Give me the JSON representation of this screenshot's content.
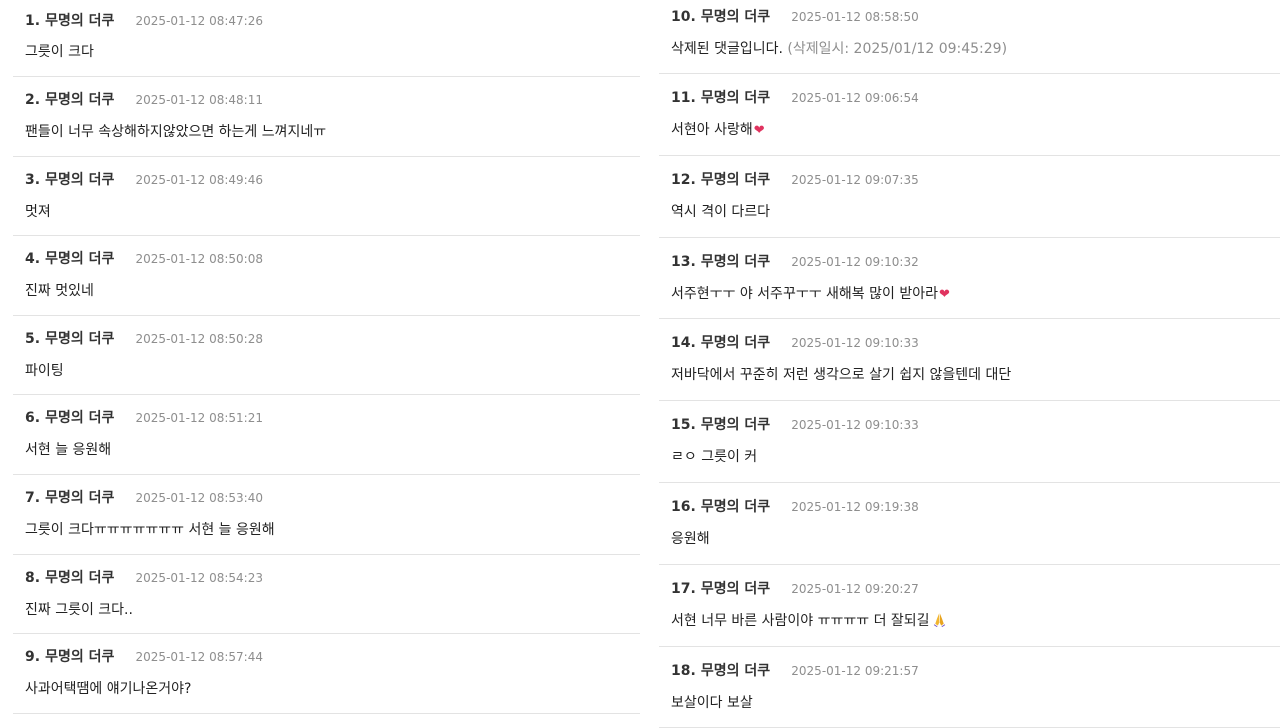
{
  "comments_left": [
    {
      "num": "1.",
      "author": "무명의 더쿠",
      "date": "2025-01-12 08:47:26",
      "text": "그릇이 크다"
    },
    {
      "num": "2.",
      "author": "무명의 더쿠",
      "date": "2025-01-12 08:48:11",
      "text": "팬들이 너무 속상해하지않았으면 하는게 느껴지네ㅠ"
    },
    {
      "num": "3.",
      "author": "무명의 더쿠",
      "date": "2025-01-12 08:49:46",
      "text": "멋져"
    },
    {
      "num": "4.",
      "author": "무명의 더쿠",
      "date": "2025-01-12 08:50:08",
      "text": "진짜 멋있네"
    },
    {
      "num": "5.",
      "author": "무명의 더쿠",
      "date": "2025-01-12 08:50:28",
      "text": "파이팅"
    },
    {
      "num": "6.",
      "author": "무명의 더쿠",
      "date": "2025-01-12 08:51:21",
      "text": "서현 늘 응원해"
    },
    {
      "num": "7.",
      "author": "무명의 더쿠",
      "date": "2025-01-12 08:53:40",
      "text": "그릇이 크다ㅠㅠㅠㅠㅠㅠㅠ 서현 늘 응원해"
    },
    {
      "num": "8.",
      "author": "무명의 더쿠",
      "date": "2025-01-12 08:54:23",
      "text": "진짜 그릇이 크다.."
    },
    {
      "num": "9.",
      "author": "무명의 더쿠",
      "date": "2025-01-12 08:57:44",
      "text": "사과어택땜에 얘기나온거야?"
    }
  ],
  "comments_right": [
    {
      "num": "10.",
      "author": "무명의 더쿠",
      "date": "2025-01-12 08:58:50",
      "text": "삭제된 댓글입니다.",
      "deleted_note": "(삭제일시: 2025/01/12 09:45:29)"
    },
    {
      "num": "11.",
      "author": "무명의 더쿠",
      "date": "2025-01-12 09:06:54",
      "text": "서현아 사랑해",
      "emoji": "heart-icon"
    },
    {
      "num": "12.",
      "author": "무명의 더쿠",
      "date": "2025-01-12 09:07:35",
      "text": "역시 격이 다르다"
    },
    {
      "num": "13.",
      "author": "무명의 더쿠",
      "date": "2025-01-12 09:10:32",
      "text": "서주현ㅜㅜ 야 서주꾸ㅜㅜ 새해복 많이 받아라",
      "emoji": "heart-icon"
    },
    {
      "num": "14.",
      "author": "무명의 더쿠",
      "date": "2025-01-12 09:10:33",
      "text": "저바닥에서 꾸준히 저런 생각으로 살기 쉽지 않을텐데 대단"
    },
    {
      "num": "15.",
      "author": "무명의 더쿠",
      "date": "2025-01-12 09:10:33",
      "text": "ㄹㅇ 그릇이 커"
    },
    {
      "num": "16.",
      "author": "무명의 더쿠",
      "date": "2025-01-12 09:19:38",
      "text": "응원해"
    },
    {
      "num": "17.",
      "author": "무명의 더쿠",
      "date": "2025-01-12 09:20:27",
      "text": "서현 너무 바른 사람이야 ㅠㅠㅠㅠ 더 잘되길",
      "emoji": "praying-hands-icon"
    },
    {
      "num": "18.",
      "author": "무명의 더쿠",
      "date": "2025-01-12 09:21:57",
      "text": "보살이다 보살"
    }
  ],
  "colors": {
    "author": "#333333",
    "date": "#8e8e8e",
    "divider": "#e3e3e3",
    "heart": "#e0335f",
    "praying_hands": "#f2b630"
  }
}
